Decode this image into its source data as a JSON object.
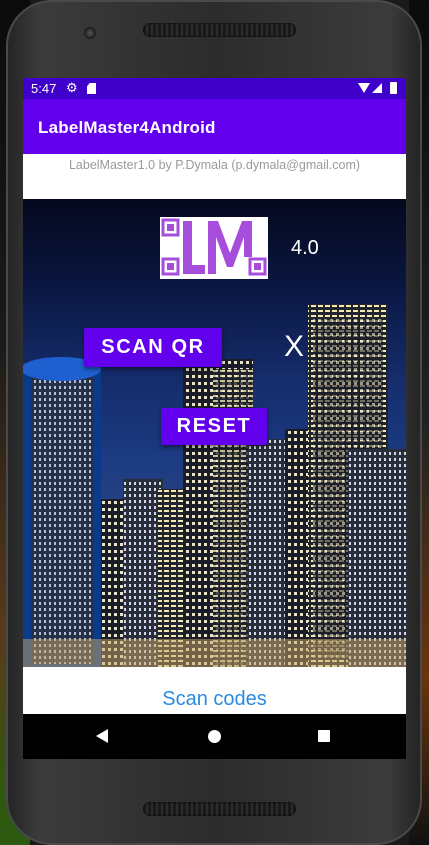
{
  "statusbar": {
    "time": "5:47"
  },
  "appbar": {
    "title": "LabelMaster4Android"
  },
  "credit": "LabelMaster1.0 by P.Dymala (p.dymala@gmail.com)",
  "logo": {
    "letters": "LM"
  },
  "version": "4.0",
  "buttons": {
    "scan_qr": "SCAN QR",
    "reset": "RESET"
  },
  "scan_status": "X",
  "footer": {
    "link": "Scan codes"
  },
  "icons": {
    "statusbar": [
      "gear-icon",
      "sd-card-icon",
      "wifi-icon",
      "signal-icon",
      "battery-icon"
    ],
    "navbar": [
      "back-icon",
      "home-icon",
      "recents-icon"
    ]
  },
  "colors": {
    "statusbar": "#3f00c9",
    "appbar": "#6200ee",
    "button": "#6200ee",
    "link": "#2a8be0",
    "logo": "#a64ddb"
  }
}
